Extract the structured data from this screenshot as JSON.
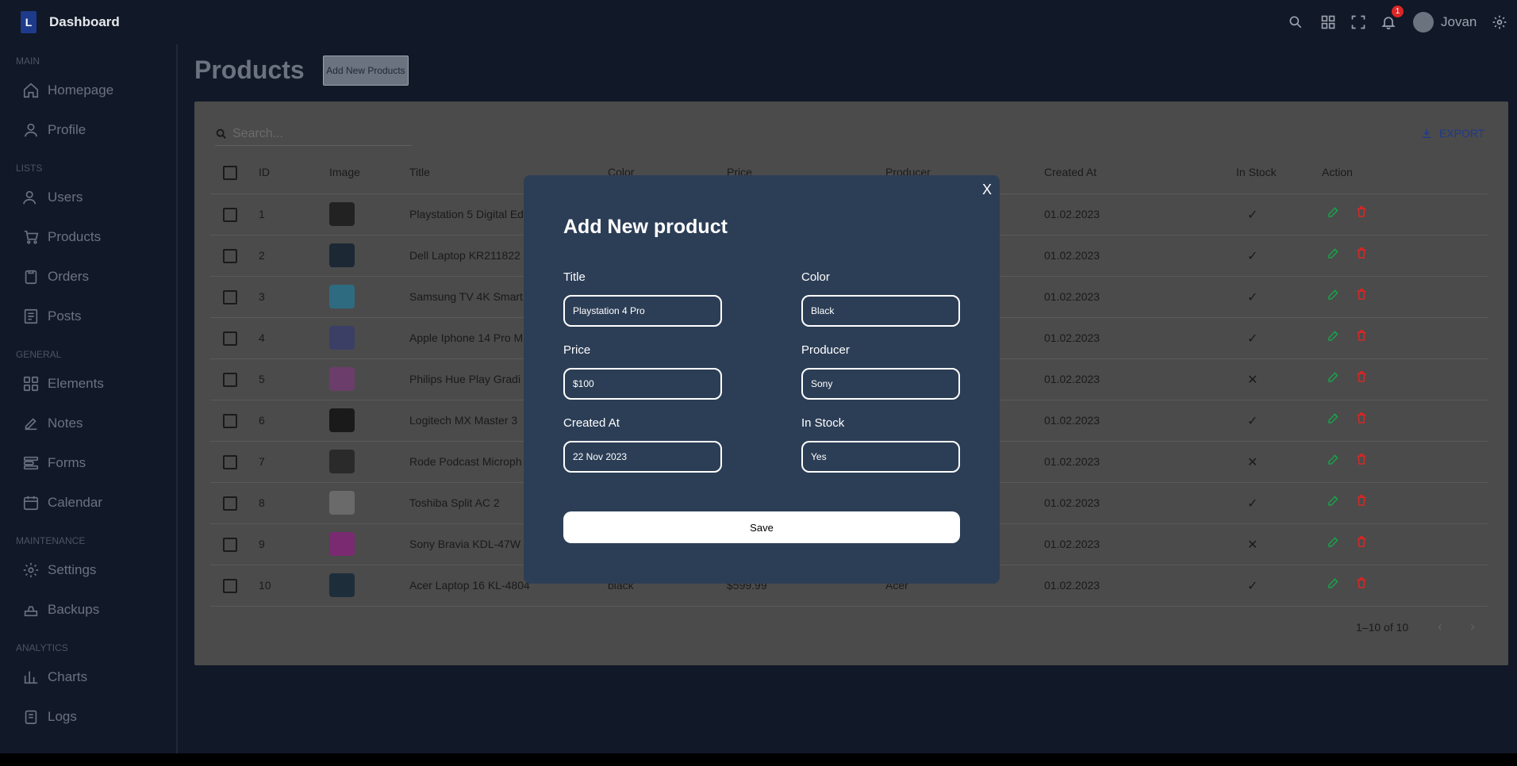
{
  "navbar": {
    "logo_letter": "L",
    "brand": "Dashboard",
    "notification_count": "1",
    "username": "Jovan"
  },
  "sidebar": {
    "sections": [
      "MAIN",
      "LISTS",
      "GENERAL",
      "MAINTENANCE",
      "ANALYTICS"
    ],
    "items": [
      {
        "label": "Homepage",
        "icon": "home-icon"
      },
      {
        "label": "Profile",
        "icon": "user-icon"
      },
      {
        "label": "Users",
        "icon": "users-icon"
      },
      {
        "label": "Products",
        "icon": "cart-icon"
      },
      {
        "label": "Orders",
        "icon": "clipboard-icon"
      },
      {
        "label": "Posts",
        "icon": "document-icon"
      },
      {
        "label": "Elements",
        "icon": "grid-icon"
      },
      {
        "label": "Notes",
        "icon": "edit-icon"
      },
      {
        "label": "Forms",
        "icon": "forms-icon"
      },
      {
        "label": "Calendar",
        "icon": "calendar-icon"
      },
      {
        "label": "Settings",
        "icon": "gear-icon"
      },
      {
        "label": "Backups",
        "icon": "backup-icon"
      },
      {
        "label": "Charts",
        "icon": "chart-icon"
      },
      {
        "label": "Logs",
        "icon": "logs-icon"
      }
    ]
  },
  "main": {
    "page_title": "Products",
    "add_button": "Add New Products",
    "search_placeholder": "Search...",
    "export_label": "EXPORT"
  },
  "table": {
    "headers": [
      "ID",
      "Image",
      "Title",
      "Color",
      "Price",
      "Producer",
      "Created At",
      "In Stock",
      "Action"
    ],
    "rows": [
      {
        "id": "1",
        "title": "Playstation 5 Digital Ed",
        "created": "01.02.2023",
        "in_stock": true,
        "thumb": "#222"
      },
      {
        "id": "2",
        "title": "Dell Laptop KR211822",
        "created": "01.02.2023",
        "in_stock": true,
        "thumb": "#1c2833"
      },
      {
        "id": "3",
        "title": "Samsung TV 4K Smart",
        "created": "01.02.2023",
        "in_stock": true,
        "thumb": "#2e6b80"
      },
      {
        "id": "4",
        "title": "Apple Iphone 14 Pro M",
        "created": "01.02.2023",
        "in_stock": true,
        "thumb": "#3b3f66"
      },
      {
        "id": "5",
        "title": "Philips Hue Play Gradi",
        "created": "01.02.2023",
        "in_stock": false,
        "thumb": "#6b3d6b"
      },
      {
        "id": "6",
        "title": "Logitech MX Master 3",
        "created": "01.02.2023",
        "in_stock": true,
        "thumb": "#1a1a1a"
      },
      {
        "id": "7",
        "title": "Rode Podcast Microph",
        "created": "01.02.2023",
        "in_stock": false,
        "thumb": "#2a2a2a"
      },
      {
        "id": "8",
        "title": "Toshiba Split AC 2",
        "created": "01.02.2023",
        "in_stock": true,
        "thumb": "#6a6a6a"
      },
      {
        "id": "9",
        "title": "Sony Bravia KDL-47W",
        "created": "01.02.2023",
        "in_stock": false,
        "thumb": "#7a2a70"
      },
      {
        "id": "10",
        "title": "Acer Laptop 16 KL-4804",
        "color": "black",
        "price": "$599.99",
        "producer": "Acer",
        "created": "01.02.2023",
        "in_stock": true,
        "thumb": "#1e2d3a"
      }
    ],
    "pager": "1–10 of 10"
  },
  "modal": {
    "close": "X",
    "title": "Add New product",
    "fields": {
      "title": {
        "label": "Title",
        "value": "Playstation 4 Pro"
      },
      "color": {
        "label": "Color",
        "value": "Black"
      },
      "price": {
        "label": "Price",
        "value": "$100"
      },
      "producer": {
        "label": "Producer",
        "value": "Sony"
      },
      "created": {
        "label": "Created At",
        "value": "22 Nov 2023"
      },
      "in_stock": {
        "label": "In Stock",
        "value": "Yes"
      }
    },
    "save": "Save"
  },
  "colors": {
    "background": "#111827",
    "modal": "#2c3e56",
    "edit": "#16a34a",
    "delete": "#dc2626",
    "notif": "#dc2626"
  }
}
